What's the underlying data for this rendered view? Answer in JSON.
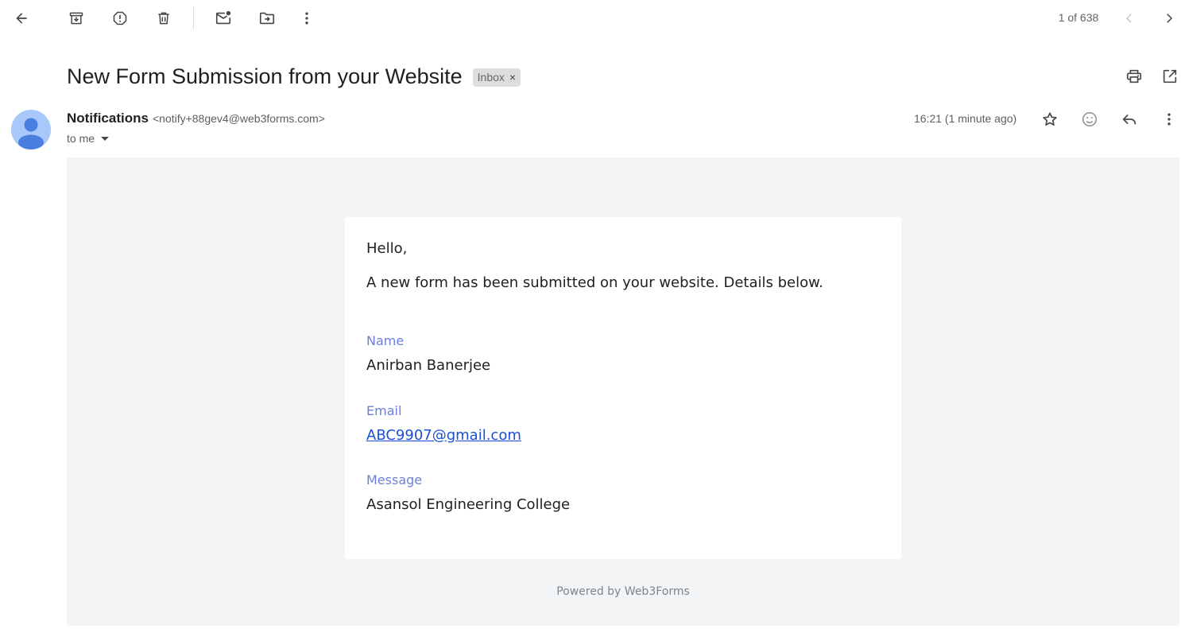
{
  "toolbar": {
    "back_icon": "arrow-left-icon",
    "archive_icon": "archive-icon",
    "spam_icon": "report-spam-icon",
    "delete_icon": "trash-icon",
    "mark_unread_icon": "mark-unread-icon",
    "move_to_icon": "move-to-folder-icon",
    "more_icon": "more-vert-icon",
    "pager_text": "1 of 638",
    "prev_icon": "chevron-left-icon",
    "next_icon": "chevron-right-icon"
  },
  "email": {
    "subject": "New Form Submission from your Website",
    "label": "Inbox",
    "label_remove": "×",
    "print_icon": "print-icon",
    "new_window_icon": "open-in-new-icon",
    "sender_name": "Notifications",
    "sender_email": "<notify+88gev4@web3forms.com>",
    "recipient_text": "to me",
    "timestamp": "16:21 (1 minute ago)",
    "star_icon": "star-icon",
    "emoji_icon": "emoji-icon",
    "reply_icon": "reply-icon",
    "more_icon": "more-vert-icon"
  },
  "message": {
    "greeting": "Hello,",
    "intro": "A new form has been submitted on your website. Details below.",
    "fields": [
      {
        "label": "Name",
        "value": "Anirban Banerjee"
      },
      {
        "label": "Email",
        "value": "ABC9907@gmail.com"
      },
      {
        "label": "Message",
        "value": "Asansol Engineering College"
      }
    ],
    "footer": "Powered by Web3Forms"
  },
  "colors": {
    "field_label": "#6b7fd7",
    "link": "#1a4fd6",
    "body_background": "#f3f4f6",
    "avatar": "#a8c7fa",
    "avatar_figure": "#4a7fe0"
  }
}
